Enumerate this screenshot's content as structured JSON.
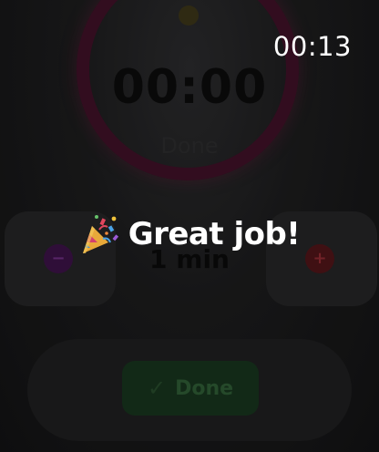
{
  "status_bar": {
    "clock": "00:13"
  },
  "background_app": {
    "timer_display": "00:00",
    "timer_status": "Done",
    "duration": "1 min",
    "decrement_symbol": "−",
    "increment_symbol": "+",
    "done_button": {
      "check": "✓",
      "label": "Done"
    }
  },
  "toast": {
    "icon": "party-popper-icon",
    "message": "Great job!"
  },
  "colors": {
    "ring": "#3d1026",
    "done_button_bg": "#17331d",
    "decrement_button": "#3a1245",
    "increment_button": "#4d1418",
    "toast_text": "#ffffff"
  }
}
